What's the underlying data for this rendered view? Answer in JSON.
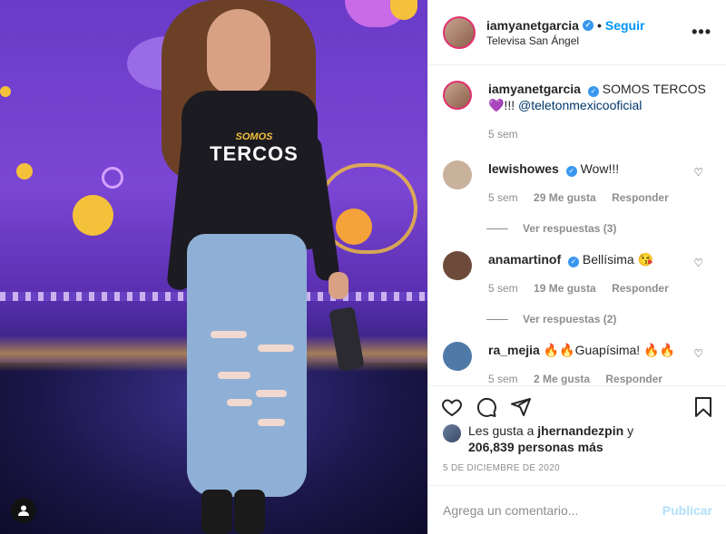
{
  "post": {
    "username": "iamyanetgarcia",
    "follow_label": "Seguir",
    "location": "Televisa San Ángel",
    "dot": "•",
    "more_label": "•••",
    "shirt_text_top": "SOMOS",
    "shirt_text_main": "TERCOS"
  },
  "caption": {
    "username": "iamyanetgarcia",
    "text": "SOMOS TERCOS",
    "emoji": "💜!!! ",
    "mention": "@teletonmexicooficial",
    "time": "5 sem"
  },
  "comments": [
    {
      "username": "lewishowes",
      "text": "Wow!!!",
      "time": "5 sem",
      "likes": "29 Me gusta",
      "reply_label": "Responder",
      "view_replies": "Ver respuestas (3)",
      "avatar_color": "#c9b29c"
    },
    {
      "username": "anamartinof",
      "text": "Bellísima 😘",
      "time": "5 sem",
      "likes": "19 Me gusta",
      "reply_label": "Responder",
      "view_replies": "Ver respuestas (2)",
      "avatar_color": "#6e4a3a"
    },
    {
      "username": "ra_mejia",
      "text": "🔥🔥Guapísima! 🔥🔥",
      "time": "5 sem",
      "likes": "2 Me gusta",
      "reply_label": "Responder",
      "avatar_color": "#4f7aa8"
    }
  ],
  "likes": {
    "prefix": "Les gusta a ",
    "user": "jhernandezpin",
    "suffix": " y",
    "others": "206,839 personas más"
  },
  "date": "5 DE DICIEMBRE DE 2020",
  "add_comment": {
    "placeholder": "Agrega un comentario...",
    "publish_label": "Publicar"
  },
  "colors": {
    "accent": "#0095f6",
    "verified": "#3897f0",
    "muted": "#8e8e8e",
    "publish_disabled": "#b2dffc"
  }
}
